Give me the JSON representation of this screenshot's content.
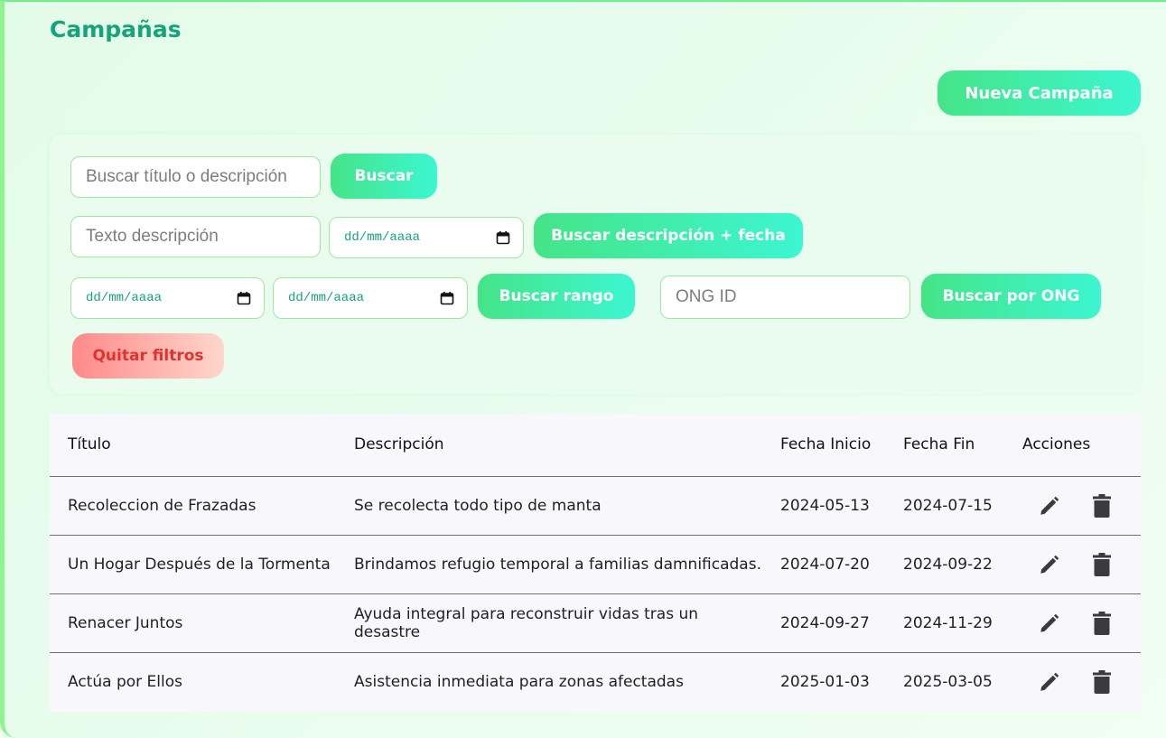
{
  "page": {
    "title": "Campañas"
  },
  "toolbar": {
    "new_campaign_label": "Nueva Campaña"
  },
  "filters": {
    "search": {
      "placeholder": "Buscar título o descripción",
      "button": "Buscar"
    },
    "desc_date": {
      "text_placeholder": "Texto descripción",
      "date_placeholder": "dd/mm/aaaa",
      "button": "Buscar descripción + fecha"
    },
    "range": {
      "from_placeholder": "dd/mm/aaaa",
      "to_placeholder": "dd/mm/aaaa",
      "button": "Buscar rango"
    },
    "ong": {
      "placeholder": "ONG ID",
      "button": "Buscar por ONG"
    },
    "clear_label": "Quitar filtros"
  },
  "table": {
    "headers": [
      "Título",
      "Descripción",
      "Fecha Inicio",
      "Fecha Fin",
      "Acciones"
    ],
    "rows": [
      {
        "title": "Recoleccion de Frazadas",
        "description": "Se recolecta todo tipo de manta",
        "start": "2024-05-13",
        "end": "2024-07-15"
      },
      {
        "title": "Un Hogar Después de la Tormenta",
        "description": "Brindamos refugio temporal a familias damnificadas.",
        "start": "2024-07-20",
        "end": "2024-09-22"
      },
      {
        "title": "Renacer Juntos",
        "description": "Ayuda integral para reconstruir vidas tras un desastre",
        "start": "2024-09-27",
        "end": "2024-11-29"
      },
      {
        "title": "Actúa por Ellos",
        "description": "Asistencia inmediata para zonas afectadas",
        "start": "2025-01-03",
        "end": "2025-03-05"
      }
    ]
  },
  "icons": {
    "edit": "pencil-icon",
    "delete": "trash-icon",
    "calendar": "calendar-icon"
  },
  "colors": {
    "accent": "#16a37a",
    "button_start": "#45e487",
    "button_end": "#3cf6d2",
    "danger": "#e0332f"
  }
}
